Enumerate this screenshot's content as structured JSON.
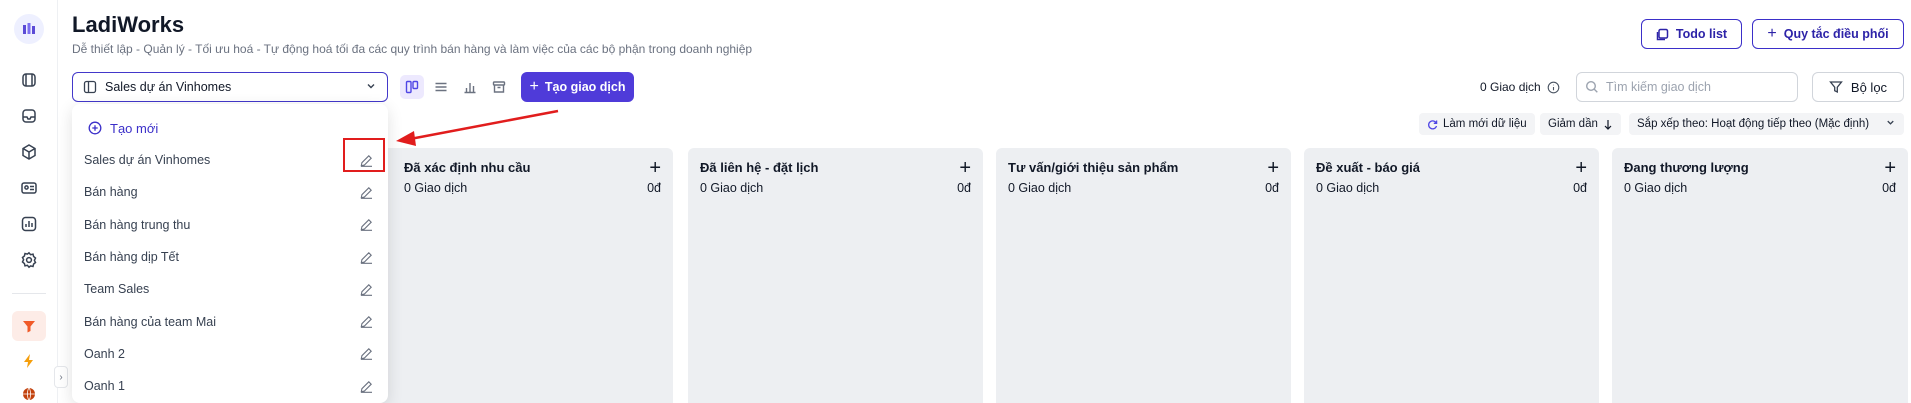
{
  "app": {
    "title": "LadiWorks",
    "subtitle": "Dễ thiết lập - Quản lý - Tối ưu hoá - Tự động hoá tối đa các quy trình bán hàng và làm việc của các bộ phận trong doanh nghiệp"
  },
  "header_buttons": {
    "todo_label": "Todo list",
    "rules_label": "Quy tắc điều phối"
  },
  "toolbar": {
    "pipeline_selected": "Sales dự án Vinhomes",
    "create_deal_label": "Tạo giao dịch",
    "deal_count": "0 Giao dịch",
    "search_placeholder": "Tìm kiếm giao dịch",
    "filter_label": "Bộ lọc",
    "refresh_label": "Làm mới dữ liệu",
    "sort_dir_label": "Giảm dần",
    "sort_by_label": "Sắp xếp theo: Hoạt động tiếp theo (Mặc định)"
  },
  "dropdown": {
    "create_label": "Tạo mới",
    "items": [
      {
        "label": "Sales dự án Vinhomes"
      },
      {
        "label": "Bán hàng"
      },
      {
        "label": "Bán hàng trung thu"
      },
      {
        "label": "Bán hàng dịp Tết"
      },
      {
        "label": "Team Sales"
      },
      {
        "label": "Bán hàng của team Mai"
      },
      {
        "label": "Oanh 2"
      },
      {
        "label": "Oanh 1"
      }
    ]
  },
  "columns": [
    {
      "title": "Đã xác định nhu cầu",
      "count": "0 Giao dịch",
      "amount": "0đ"
    },
    {
      "title": "Đã liên hệ - đặt lịch",
      "count": "0 Giao dịch",
      "amount": "0đ"
    },
    {
      "title": "Tư vấn/giới thiệu sản phẩm",
      "count": "0 Giao dịch",
      "amount": "0đ"
    },
    {
      "title": "Đề xuất - báo giá",
      "count": "0 Giao dịch",
      "amount": "0đ"
    },
    {
      "title": "Đang thương lượng",
      "count": "0 Giao dịch",
      "amount": "0đ"
    }
  ],
  "colors": {
    "accent": "#4f3bd9",
    "annotation_red": "#e11d1d",
    "column_bg": "#edeff2"
  },
  "icons": [
    "app-logo-icon",
    "box-icon",
    "inbox-icon",
    "cube-icon",
    "contact-card-icon",
    "chart-icon",
    "settings-icon",
    "funnel-icon",
    "bolt-icon",
    "globe-icon",
    "pencil-icon",
    "plus-icon",
    "search-icon",
    "filter-icon",
    "refresh-icon",
    "info-icon",
    "kanban-view-icon",
    "list-view-icon",
    "report-view-icon",
    "archive-view-icon"
  ]
}
